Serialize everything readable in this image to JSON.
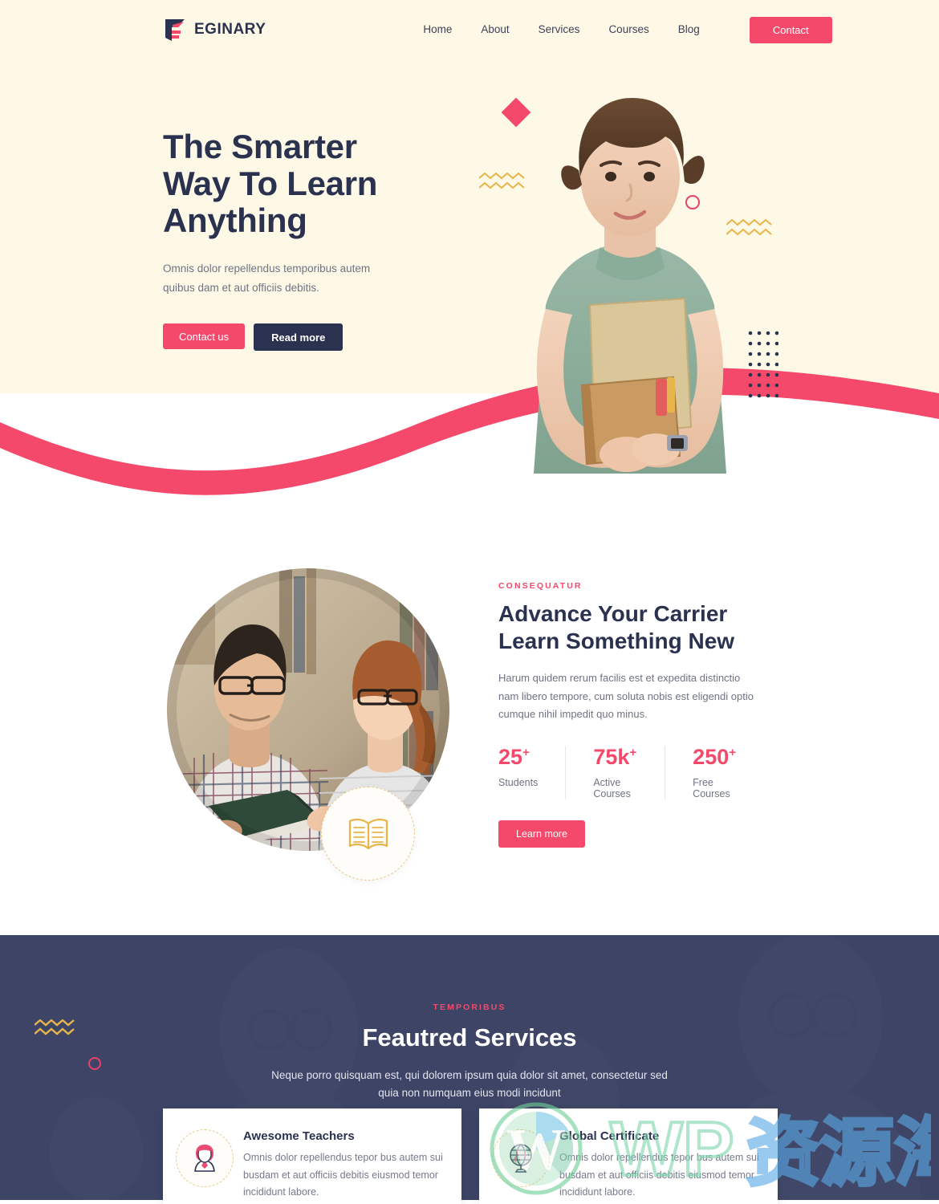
{
  "header": {
    "logo_text": "EGINARY",
    "logo_icon": "eginary-flag-logo",
    "nav": [
      {
        "label": "Home"
      },
      {
        "label": "About"
      },
      {
        "label": "Services"
      },
      {
        "label": "Courses"
      },
      {
        "label": "Blog"
      }
    ],
    "contact_label": "Contact"
  },
  "hero": {
    "title_line1": "The Smarter",
    "title_line2": "Way To Learn",
    "title_line3": "Anything",
    "subtitle": "Omnis dolor repellendus temporibus autem quibus dam et aut officiis debitis.",
    "primary_btn": "Contact us",
    "secondary_btn": "Read more",
    "photo_alt": "smiling-student-holding-books",
    "decorations": [
      "pink-diamond",
      "yellow-zigzag",
      "pink-circle-outline",
      "navy-dot-grid"
    ]
  },
  "about": {
    "eyebrow": "CONSEQUATUR",
    "title_line1": "Advance Your Carrier",
    "title_line2": "Learn Something New",
    "text": "Harum quidem rerum facilis est et expedita distinctio nam libero tempore, cum soluta nobis est eligendi optio cumque nihil impedit quo minus.",
    "photo_alt": "two-students-reading-in-library",
    "badge_icon": "open-book-icon",
    "stats": [
      {
        "value": "25",
        "suffix": "+",
        "label": "Students"
      },
      {
        "value": "75k",
        "suffix": "+",
        "label": "Active Courses"
      },
      {
        "value": "250",
        "suffix": "+",
        "label": "Free Courses"
      }
    ],
    "cta_label": "Learn more"
  },
  "services": {
    "eyebrow": "TEMPORIBUS",
    "title": "Feautred Services",
    "subtitle": "Neque porro quisquam est, qui dolorem ipsum quia dolor sit amet, consectetur sed quia non numquam eius modi incidunt",
    "cards": [
      {
        "icon": "teacher-avatar-icon",
        "title": "Awesome Teachers",
        "text": "Omnis dolor repellendus tepor bus autem sui busdam et aut officiis debitis eiusmod temor incididunt labore."
      },
      {
        "icon": "globe-certificate-icon",
        "title": "Global Certificate",
        "text": "Omnis dolor repellendus tepor bus autem sui busdam et aut officiis debitis eiusmod temor incididunt labore."
      }
    ]
  },
  "watermark": {
    "text": "WP资源海",
    "logo": "wordpress-logo"
  },
  "colors": {
    "accent_pink": "#f4496a",
    "navy": "#2b3250",
    "cream": "#fdf9e6",
    "dark_section": "#3b4264",
    "gold": "#e8b54a"
  }
}
